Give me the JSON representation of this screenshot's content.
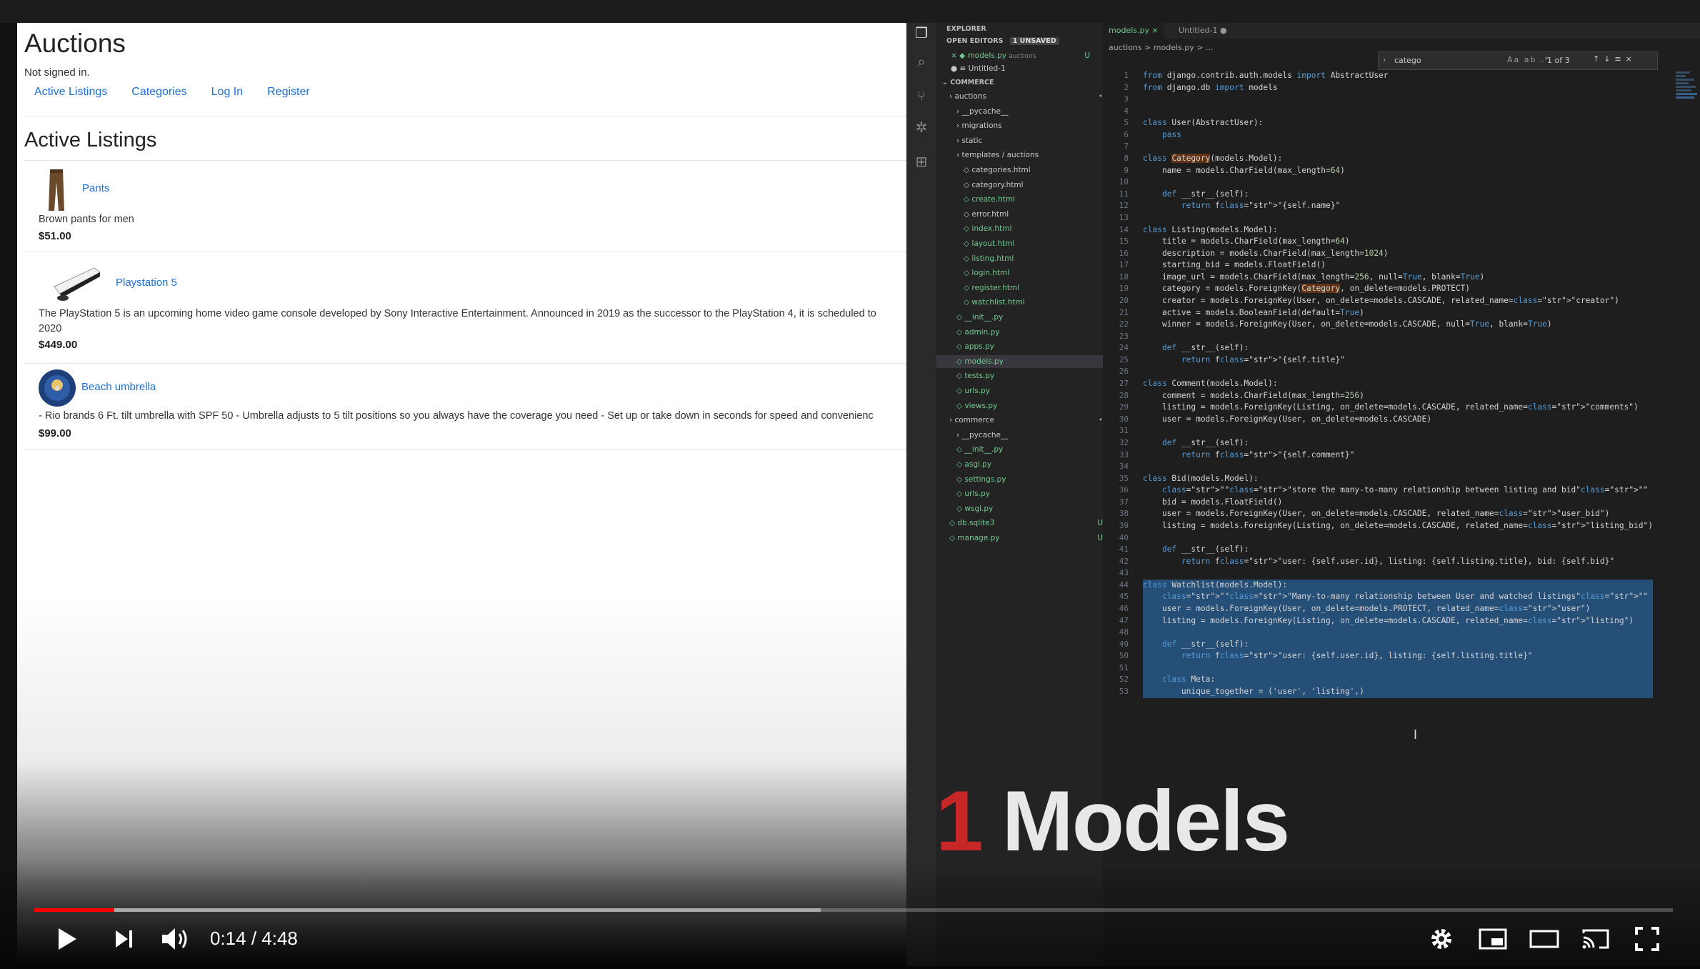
{
  "site": {
    "title": "Auctions",
    "signin_status": "Not signed in.",
    "nav": [
      "Active Listings",
      "Categories",
      "Log In",
      "Register"
    ],
    "section_title": "Active Listings",
    "listings": [
      {
        "title": "Pants",
        "description": "Brown pants for men",
        "price": "$51.00"
      },
      {
        "title": "Playstation 5",
        "description": "The PlayStation 5 is an upcoming home video game console developed by Sony Interactive Entertainment. Announced in 2019 as the successor to the PlayStation 4, it is scheduled to",
        "description2": "2020",
        "price": "$449.00"
      },
      {
        "title": "Beach umbrella",
        "description": "- Rio brands 6 Ft. tilt umbrella with SPF 50 - Umbrella adjusts to 5 tilt positions so you always have the coverage you need - Set up or take down in seconds for speed and convenienc",
        "price": "$99.00"
      }
    ]
  },
  "vscode": {
    "explorer_title": "EXPLORER",
    "open_editors": "OPEN EDITORS",
    "unsaved_badge": "1 UNSAVED",
    "open_files": [
      {
        "name": "models.py",
        "hint": "auctions",
        "status": "U"
      },
      {
        "name": "Untitled-1",
        "hint": "",
        "status": ""
      }
    ],
    "project": "COMMERCE",
    "tree": [
      {
        "name": "auctions",
        "level": 1,
        "status": "•"
      },
      {
        "name": "__pycache__",
        "level": 2,
        "status": "•"
      },
      {
        "name": "migrations",
        "level": 2,
        "status": "•"
      },
      {
        "name": "static",
        "level": 2,
        "status": "•"
      },
      {
        "name": "templates / auctions",
        "level": 2,
        "status": "•"
      },
      {
        "name": "categories.html",
        "level": 3,
        "status": ""
      },
      {
        "name": "category.html",
        "level": 3,
        "status": ""
      },
      {
        "name": "create.html",
        "level": 3,
        "status": "U"
      },
      {
        "name": "error.html",
        "level": 3,
        "status": ""
      },
      {
        "name": "index.html",
        "level": 3,
        "status": "U"
      },
      {
        "name": "layout.html",
        "level": 3,
        "status": "U"
      },
      {
        "name": "listing.html",
        "level": 3,
        "status": "U"
      },
      {
        "name": "login.html",
        "level": 3,
        "status": "U"
      },
      {
        "name": "register.html",
        "level": 3,
        "status": "U"
      },
      {
        "name": "watchlist.html",
        "level": 3,
        "status": "U"
      },
      {
        "name": "__init__.py",
        "level": 2,
        "status": "U"
      },
      {
        "name": "admin.py",
        "level": 2,
        "status": "U"
      },
      {
        "name": "apps.py",
        "level": 2,
        "status": "U"
      },
      {
        "name": "models.py",
        "level": 2,
        "status": "U"
      },
      {
        "name": "tests.py",
        "level": 2,
        "status": "U"
      },
      {
        "name": "urls.py",
        "level": 2,
        "status": "U"
      },
      {
        "name": "views.py",
        "level": 2,
        "status": "U"
      },
      {
        "name": "commerce",
        "level": 1,
        "status": "•"
      },
      {
        "name": "__pycache__",
        "level": 2,
        "status": "•"
      },
      {
        "name": "__init__.py",
        "level": 2,
        "status": "U"
      },
      {
        "name": "asgi.py",
        "level": 2,
        "status": "U"
      },
      {
        "name": "settings.py",
        "level": 2,
        "status": "U"
      },
      {
        "name": "urls.py",
        "level": 2,
        "status": "U"
      },
      {
        "name": "wsgi.py",
        "level": 2,
        "status": "U"
      },
      {
        "name": "db.sqlite3",
        "level": 1,
        "status": "U"
      },
      {
        "name": "manage.py",
        "level": 1,
        "status": "U"
      }
    ],
    "tabs": [
      {
        "label": "models.py ×"
      },
      {
        "label": "Untitled-1 ●"
      }
    ],
    "breadcrumb": "auctions > models.py > ...",
    "find_query": "catego",
    "find_count": "1 of 3",
    "code_lines": [
      "from django.contrib.auth.models import AbstractUser",
      "from django.db import models",
      "",
      "",
      "class User(AbstractUser):",
      "    pass",
      "",
      "class Category(models.Model):",
      "    name = models.CharField(max_length=64)",
      "",
      "    def __str__(self):",
      "        return f\"{self.name}\"",
      "",
      "class Listing(models.Model):",
      "    title = models.CharField(max_length=64)",
      "    description = models.CharField(max_length=1024)",
      "    starting_bid = models.FloatField()",
      "    image_url = models.CharField(max_length=256, null=True, blank=True)",
      "    category = models.ForeignKey(Category, on_delete=models.PROTECT)",
      "    creator = models.ForeignKey(User, on_delete=models.CASCADE, related_name=\"creator\")",
      "    active = models.BooleanField(default=True)",
      "    winner = models.ForeignKey(User, on_delete=models.CASCADE, null=True, blank=True)",
      "",
      "    def __str__(self):",
      "        return f\"{self.title}\"",
      "",
      "class Comment(models.Model):",
      "    comment = models.CharField(max_length=256)",
      "    listing = models.ForeignKey(Listing, on_delete=models.CASCADE, related_name=\"comments\")",
      "    user = models.ForeignKey(User, on_delete=models.CASCADE)",
      "",
      "    def __str__(self):",
      "        return f\"{self.comment}\"",
      "",
      "class Bid(models.Model):",
      "    \"\"\"store the many-to-many relationship between listing and bid\"\"\"",
      "    bid = models.FloatField()",
      "    user = models.ForeignKey(User, on_delete=models.CASCADE, related_name=\"user_bid\")",
      "    listing = models.ForeignKey(Listing, on_delete=models.CASCADE, related_name=\"listing_bid\")",
      "",
      "    def __str__(self):",
      "        return f\"user: {self.user.id}, listing: {self.listing.title}, bid: {self.bid}\"",
      "",
      "class Watchlist(models.Model):",
      "    \"\"\"Many-to-many relationship between User and watched listings\"\"\"",
      "    user = models.ForeignKey(User, on_delete=models.PROTECT, related_name=\"user\")",
      "    listing = models.ForeignKey(Listing, on_delete=models.CASCADE, related_name=\"listing\")",
      "",
      "    def __str__(self):",
      "        return f\"user: {self.user.id}, listing: {self.listing.title}\"",
      "",
      "    class Meta:",
      "        unique_together = ('user', 'listing',)"
    ]
  },
  "overlay": {
    "number": "1",
    "text": "Models"
  },
  "player": {
    "time": "0:14 / 4:48",
    "played_fraction": 0.049,
    "buffered_fraction": 0.48,
    "accent": "#ff0000"
  }
}
